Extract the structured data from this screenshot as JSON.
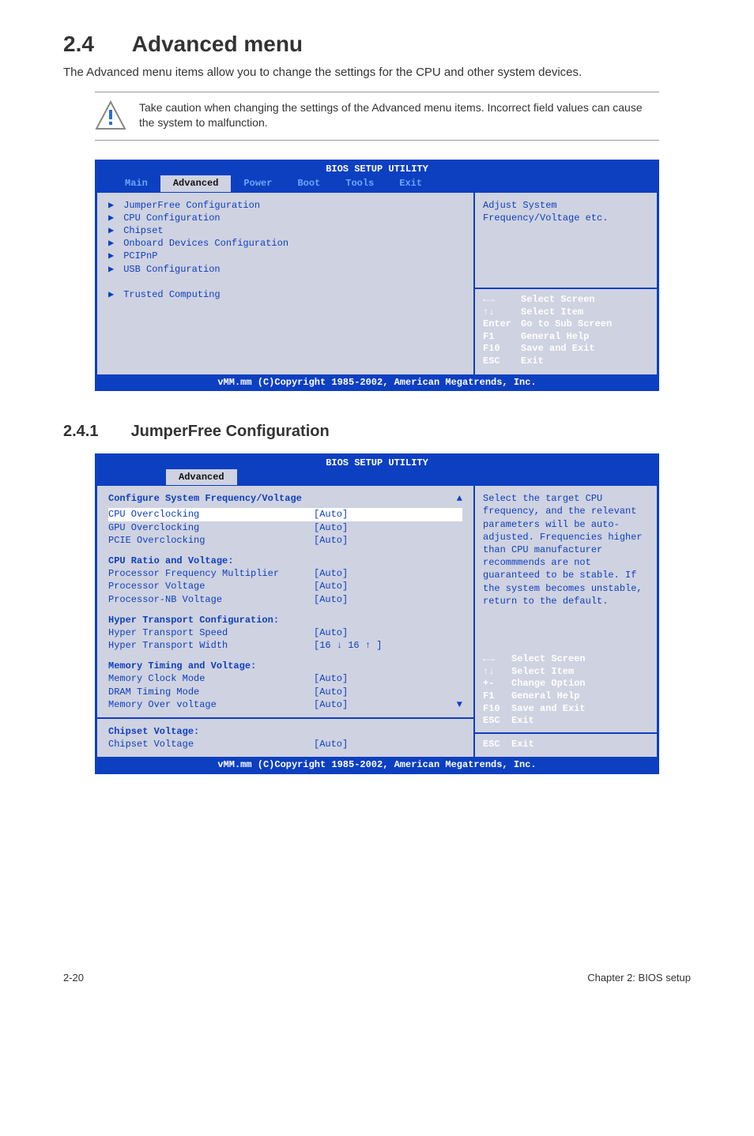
{
  "page": {
    "heading_num": "2.4",
    "heading_text": "Advanced menu",
    "intro": "The Advanced menu items allow you to change the settings for the CPU and other system devices.",
    "note": "Take caution when changing the settings of the Advanced menu items. Incorrect field values can cause the system to malfunction.",
    "sub_num": "2.4.1",
    "sub_text": "JumperFree Configuration",
    "footer_left": "2-20",
    "footer_right": "Chapter 2: BIOS setup"
  },
  "bios1": {
    "title": "BIOS SETUP UTILITY",
    "tabs": [
      "Main",
      "Advanced",
      "Power",
      "Boot",
      "Tools",
      "Exit"
    ],
    "active_tab": "Advanced",
    "items": [
      "JumperFree Configuration",
      "CPU Configuration",
      "Chipset",
      "Onboard Devices Configuration",
      "PCIPnP",
      "USB Configuration",
      "",
      "Trusted Computing"
    ],
    "help": "Adjust System Frequency/Voltage etc.",
    "keys": [
      {
        "k": "←→",
        "d": "Select Screen"
      },
      {
        "k": "↑↓",
        "d": "Select Item"
      },
      {
        "k": "Enter",
        "d": "Go to Sub Screen"
      },
      {
        "k": "F1",
        "d": "General Help"
      },
      {
        "k": "F10",
        "d": "Save and Exit"
      },
      {
        "k": "ESC",
        "d": "Exit"
      }
    ],
    "footer": "vMM.mm (C)Copyright 1985-2002, American Megatrends, Inc."
  },
  "bios2": {
    "title": "BIOS SETUP UTILITY",
    "active_tab": "Advanced",
    "header": "Configure System Frequency/Voltage",
    "groups": [
      {
        "title": "",
        "items": [
          {
            "label": "CPU Overclocking",
            "value": "[Auto]",
            "sel": true
          },
          {
            "label": "GPU Overclocking",
            "value": "[Auto]"
          },
          {
            "label": "PCIE Overclocking",
            "value": "[Auto]"
          }
        ]
      },
      {
        "title": "CPU Ratio and Voltage:",
        "items": [
          {
            "label": "Processor Frequency Multiplier",
            "value": "[Auto]"
          },
          {
            "label": "Processor Voltage",
            "value": "[Auto]"
          },
          {
            "label": "Processor-NB Voltage",
            "value": "[Auto]"
          }
        ]
      },
      {
        "title": "Hyper Transport Configuration:",
        "items": [
          {
            "label": "Hyper Transport Speed",
            "value": "[Auto]"
          },
          {
            "label": "Hyper Transport Width",
            "value": "[16 ↓ 16 ↑ ]"
          }
        ]
      },
      {
        "title": "Memory Timing and Voltage:",
        "items": [
          {
            "label": "Memory Clock Mode",
            "value": "[Auto]"
          },
          {
            "label": "DRAM Timing Mode",
            "value": "[Auto]"
          },
          {
            "label": "Memory Over voltage",
            "value": "[Auto]"
          }
        ]
      }
    ],
    "extra_group_title": "Chipset Voltage:",
    "extra_item": {
      "label": "Chipset Voltage",
      "value": "[Auto]"
    },
    "help": "Select the target CPU frequency, and the relevant parameters will be auto-adjusted. Frequencies higher than CPU manufacturer recommmends are not guaranteed to be stable. If the system becomes unstable, return to the default.",
    "keys": [
      {
        "k": "←→",
        "d": "Select Screen"
      },
      {
        "k": "↑↓",
        "d": "Select Item"
      },
      {
        "k": "+-",
        "d": "Change Option"
      },
      {
        "k": "F1",
        "d": "General Help"
      },
      {
        "k": "F10",
        "d": "Save and Exit"
      },
      {
        "k": "ESC",
        "d": "Exit"
      }
    ],
    "esc_exit": {
      "k": "ESC",
      "d": "Exit"
    },
    "footer": "vMM.mm (C)Copyright 1985-2002, American Megatrends, Inc."
  }
}
